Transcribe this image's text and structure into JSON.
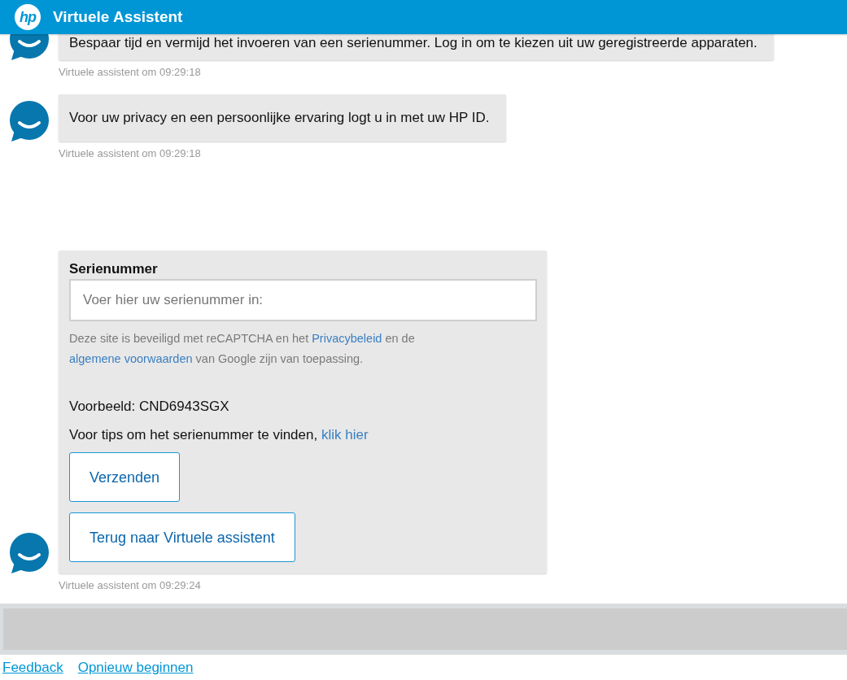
{
  "header": {
    "logo_text": "hp",
    "title": "Virtuele Assistent"
  },
  "messages": [
    {
      "kind": "text",
      "text": "Bespaar tijd en vermijd het invoeren van een serienummer. Log in om te kiezen uit uw geregistreerde apparaten.",
      "timestamp": "Virtuele assistent om 09:29:18"
    },
    {
      "kind": "text",
      "text": "Voor uw privacy en een persoonlijke ervaring logt u in met uw HP ID.",
      "timestamp": "Virtuele assistent om 09:29:18"
    },
    {
      "kind": "form",
      "label": "Serienummer",
      "input": {
        "placeholder": "Voer hier uw serienummer in:"
      },
      "disclaimer": [
        {
          "kind": "text",
          "text": "Deze site is beveiligd met reCAPTCHA en het "
        },
        {
          "kind": "link",
          "text": "Privacybeleid"
        },
        {
          "kind": "text",
          "text": " en de "
        },
        {
          "kind": "link",
          "text": "algemene voorwaarden"
        },
        {
          "kind": "text",
          "text": " van Google zijn van toepassing."
        }
      ],
      "example": "Voorbeeld: CND6943SGX",
      "tips": [
        {
          "kind": "text",
          "text": "Voor tips om het serienummer te vinden, "
        },
        {
          "kind": "link",
          "text": "klik hier"
        }
      ],
      "buttons": [
        {
          "label": "Verzenden"
        },
        {
          "label": "Terug naar Virtuele assistent"
        }
      ],
      "timestamp": "Virtuele assistent om 09:29:24"
    }
  ],
  "footer_links": [
    "Feedback",
    "Opnieuw beginnen"
  ]
}
